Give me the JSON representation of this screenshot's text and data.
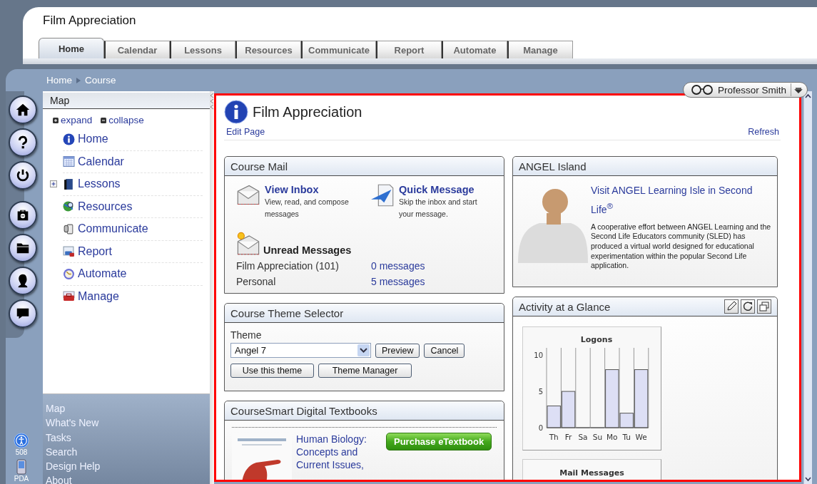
{
  "course_title": "Film Appreciation",
  "tabs": [
    {
      "label": "Home",
      "selected": true
    },
    {
      "label": "Calendar",
      "selected": false
    },
    {
      "label": "Lessons",
      "selected": false
    },
    {
      "label": "Resources",
      "selected": false
    },
    {
      "label": "Communicate",
      "selected": false
    },
    {
      "label": "Report",
      "selected": false
    },
    {
      "label": "Automate",
      "selected": false
    },
    {
      "label": "Manage",
      "selected": false
    }
  ],
  "breadcrumb": [
    "Home",
    "Course"
  ],
  "user": {
    "name": "Professor Smith"
  },
  "rail": {
    "accessibility_label": "508",
    "pda_label": "PDA"
  },
  "map": {
    "title": "Map",
    "expand": "expand",
    "collapse": "collapse",
    "items": [
      {
        "label": "Home",
        "expandable": false
      },
      {
        "label": "Calendar",
        "expandable": false
      },
      {
        "label": "Lessons",
        "expandable": true
      },
      {
        "label": "Resources",
        "expandable": false
      },
      {
        "label": "Communicate",
        "expandable": false
      },
      {
        "label": "Report",
        "expandable": false
      },
      {
        "label": "Automate",
        "expandable": false
      },
      {
        "label": "Manage",
        "expandable": false
      }
    ]
  },
  "footer_links": [
    "Map",
    "What's New",
    "Tasks",
    "Search",
    "Design Help",
    "About"
  ],
  "page": {
    "title": "Film Appreciation",
    "edit": "Edit Page",
    "refresh": "Refresh"
  },
  "course_mail": {
    "title": "Course Mail",
    "view_inbox": {
      "title": "View Inbox",
      "description": "View, read, and compose messages"
    },
    "quick_message": {
      "title": "Quick Message",
      "description": "Skip the inbox and start your message."
    },
    "unread_title": "Unread Messages",
    "unread": [
      {
        "name": "Film Appreciation (101)",
        "count": "0 messages"
      },
      {
        "name": "Personal",
        "count": "5 messages"
      }
    ]
  },
  "theme_selector": {
    "title": "Course Theme Selector",
    "label": "Theme",
    "value": "Angel 7",
    "buttons": [
      "Preview",
      "Cancel",
      "Use this theme",
      "Theme Manager"
    ]
  },
  "textbooks": {
    "title": "CourseSmart Digital Textbooks",
    "book_title": "Human Biology: Concepts and Current Issues,",
    "purchase": "Purchase eTextbook"
  },
  "island": {
    "title": "ANGEL Island",
    "link": "Visit ANGEL Learning Isle in Second Life$^{®}$",
    "description": "A cooperative effort between ANGEL Learning and the Second Life Educators community (SLED) has produced a virtual world designed for educational experimentation within the popular Second Life application."
  },
  "activity": {
    "title": "Activity at a Glance",
    "chart_data": {
      "type": "bar",
      "title": "Logons",
      "categories": [
        "Th",
        "Fr",
        "Sa",
        "Su",
        "Mo",
        "Tu",
        "We"
      ],
      "values": [
        3,
        5,
        0,
        0,
        8,
        2,
        8
      ],
      "yticks": [
        0,
        5,
        10
      ],
      "ylim": [
        0,
        11
      ]
    },
    "second_chart_title": "Mail Messages"
  }
}
